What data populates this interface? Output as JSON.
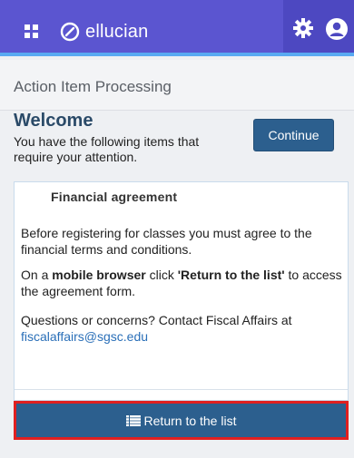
{
  "header": {
    "brand": "ellucian"
  },
  "page": {
    "title": "Action Item Processing"
  },
  "welcome": {
    "title": "Welcome",
    "text": "You have the following items that require your attention.",
    "continue_label": "Continue"
  },
  "action_item": {
    "title": "Financial agreement",
    "p1": "Before registering for classes you must agree to the financial terms and conditions.",
    "p2_pre": "On a ",
    "p2_bold1": "mobile browser",
    "p2_mid": " click ",
    "p2_bold2": "'Return to the list'",
    "p2_post": " to access the agreement form.",
    "p3": "Questions or concerns? Contact Fiscal Affairs at",
    "email": "fiscalaffairs@sgsc.edu"
  },
  "return_button": {
    "label": "Return to the list",
    "icon": "list-icon"
  },
  "colors": {
    "topbar": "#5b55d0",
    "accent_strip": "#58a9f2",
    "primary_button": "#2c5f8e",
    "highlight_border": "#e02020",
    "link": "#2a6fb8"
  }
}
